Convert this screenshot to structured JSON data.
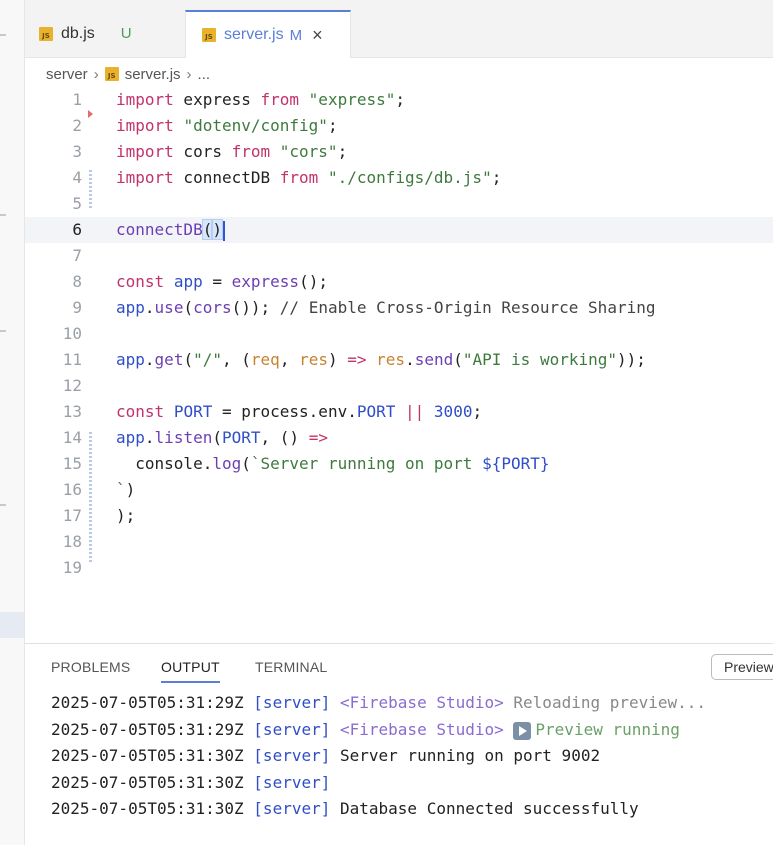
{
  "tabs": [
    {
      "name": "db.js",
      "status": "U"
    },
    {
      "name": "server.js",
      "status": "M",
      "close": "×"
    }
  ],
  "breadcrumb": {
    "folder": "server",
    "file": "server.js",
    "more": "..."
  },
  "editor": {
    "line_numbers": [
      "1",
      "2",
      "3",
      "4",
      "5",
      "6",
      "7",
      "8",
      "9",
      "10",
      "11",
      "12",
      "13",
      "14",
      "15",
      "16",
      "17",
      "18",
      "19"
    ],
    "current_line": "6"
  },
  "panel": {
    "tabs": [
      "PROBLEMS",
      "OUTPUT",
      "TERMINAL"
    ],
    "active_tab": "OUTPUT",
    "preview_button": "Preview",
    "log": [
      {
        "time": "2025-07-05T05:31:29Z",
        "tag": "[server]",
        "source": "<Firebase Studio>",
        "message": "Reloading preview..."
      },
      {
        "time": "2025-07-05T05:31:29Z",
        "tag": "[server]",
        "source": "<Firebase Studio>",
        "message": "Preview running"
      },
      {
        "time": "2025-07-05T05:31:30Z",
        "tag": "[server]",
        "source": "",
        "message": "Server running on port 9002"
      },
      {
        "time": "2025-07-05T05:31:30Z",
        "tag": "[server]",
        "source": "",
        "message": ""
      },
      {
        "time": "2025-07-05T05:31:30Z",
        "tag": "[server]",
        "source": "",
        "message": "Database Connected successfully"
      }
    ]
  },
  "icons": {
    "js_file_icon": "JS",
    "play_icon": "play"
  },
  "colors": {
    "accent": "#5b7fd6",
    "keyword": "#c0336b",
    "string": "#3e7a3e",
    "function": "#6b3fb3"
  }
}
